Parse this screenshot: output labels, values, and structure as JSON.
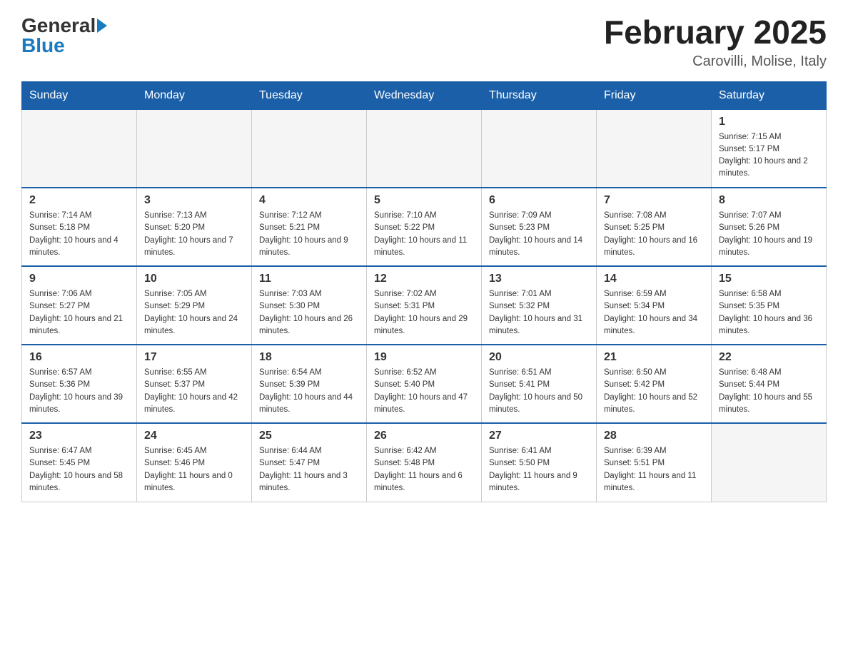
{
  "header": {
    "logo_general": "General",
    "logo_blue": "Blue",
    "month_year": "February 2025",
    "location": "Carovilli, Molise, Italy"
  },
  "days_of_week": [
    "Sunday",
    "Monday",
    "Tuesday",
    "Wednesday",
    "Thursday",
    "Friday",
    "Saturday"
  ],
  "weeks": [
    [
      {
        "num": "",
        "info": ""
      },
      {
        "num": "",
        "info": ""
      },
      {
        "num": "",
        "info": ""
      },
      {
        "num": "",
        "info": ""
      },
      {
        "num": "",
        "info": ""
      },
      {
        "num": "",
        "info": ""
      },
      {
        "num": "1",
        "info": "Sunrise: 7:15 AM\nSunset: 5:17 PM\nDaylight: 10 hours and 2 minutes."
      }
    ],
    [
      {
        "num": "2",
        "info": "Sunrise: 7:14 AM\nSunset: 5:18 PM\nDaylight: 10 hours and 4 minutes."
      },
      {
        "num": "3",
        "info": "Sunrise: 7:13 AM\nSunset: 5:20 PM\nDaylight: 10 hours and 7 minutes."
      },
      {
        "num": "4",
        "info": "Sunrise: 7:12 AM\nSunset: 5:21 PM\nDaylight: 10 hours and 9 minutes."
      },
      {
        "num": "5",
        "info": "Sunrise: 7:10 AM\nSunset: 5:22 PM\nDaylight: 10 hours and 11 minutes."
      },
      {
        "num": "6",
        "info": "Sunrise: 7:09 AM\nSunset: 5:23 PM\nDaylight: 10 hours and 14 minutes."
      },
      {
        "num": "7",
        "info": "Sunrise: 7:08 AM\nSunset: 5:25 PM\nDaylight: 10 hours and 16 minutes."
      },
      {
        "num": "8",
        "info": "Sunrise: 7:07 AM\nSunset: 5:26 PM\nDaylight: 10 hours and 19 minutes."
      }
    ],
    [
      {
        "num": "9",
        "info": "Sunrise: 7:06 AM\nSunset: 5:27 PM\nDaylight: 10 hours and 21 minutes."
      },
      {
        "num": "10",
        "info": "Sunrise: 7:05 AM\nSunset: 5:29 PM\nDaylight: 10 hours and 24 minutes."
      },
      {
        "num": "11",
        "info": "Sunrise: 7:03 AM\nSunset: 5:30 PM\nDaylight: 10 hours and 26 minutes."
      },
      {
        "num": "12",
        "info": "Sunrise: 7:02 AM\nSunset: 5:31 PM\nDaylight: 10 hours and 29 minutes."
      },
      {
        "num": "13",
        "info": "Sunrise: 7:01 AM\nSunset: 5:32 PM\nDaylight: 10 hours and 31 minutes."
      },
      {
        "num": "14",
        "info": "Sunrise: 6:59 AM\nSunset: 5:34 PM\nDaylight: 10 hours and 34 minutes."
      },
      {
        "num": "15",
        "info": "Sunrise: 6:58 AM\nSunset: 5:35 PM\nDaylight: 10 hours and 36 minutes."
      }
    ],
    [
      {
        "num": "16",
        "info": "Sunrise: 6:57 AM\nSunset: 5:36 PM\nDaylight: 10 hours and 39 minutes."
      },
      {
        "num": "17",
        "info": "Sunrise: 6:55 AM\nSunset: 5:37 PM\nDaylight: 10 hours and 42 minutes."
      },
      {
        "num": "18",
        "info": "Sunrise: 6:54 AM\nSunset: 5:39 PM\nDaylight: 10 hours and 44 minutes."
      },
      {
        "num": "19",
        "info": "Sunrise: 6:52 AM\nSunset: 5:40 PM\nDaylight: 10 hours and 47 minutes."
      },
      {
        "num": "20",
        "info": "Sunrise: 6:51 AM\nSunset: 5:41 PM\nDaylight: 10 hours and 50 minutes."
      },
      {
        "num": "21",
        "info": "Sunrise: 6:50 AM\nSunset: 5:42 PM\nDaylight: 10 hours and 52 minutes."
      },
      {
        "num": "22",
        "info": "Sunrise: 6:48 AM\nSunset: 5:44 PM\nDaylight: 10 hours and 55 minutes."
      }
    ],
    [
      {
        "num": "23",
        "info": "Sunrise: 6:47 AM\nSunset: 5:45 PM\nDaylight: 10 hours and 58 minutes."
      },
      {
        "num": "24",
        "info": "Sunrise: 6:45 AM\nSunset: 5:46 PM\nDaylight: 11 hours and 0 minutes."
      },
      {
        "num": "25",
        "info": "Sunrise: 6:44 AM\nSunset: 5:47 PM\nDaylight: 11 hours and 3 minutes."
      },
      {
        "num": "26",
        "info": "Sunrise: 6:42 AM\nSunset: 5:48 PM\nDaylight: 11 hours and 6 minutes."
      },
      {
        "num": "27",
        "info": "Sunrise: 6:41 AM\nSunset: 5:50 PM\nDaylight: 11 hours and 9 minutes."
      },
      {
        "num": "28",
        "info": "Sunrise: 6:39 AM\nSunset: 5:51 PM\nDaylight: 11 hours and 11 minutes."
      },
      {
        "num": "",
        "info": ""
      }
    ]
  ]
}
